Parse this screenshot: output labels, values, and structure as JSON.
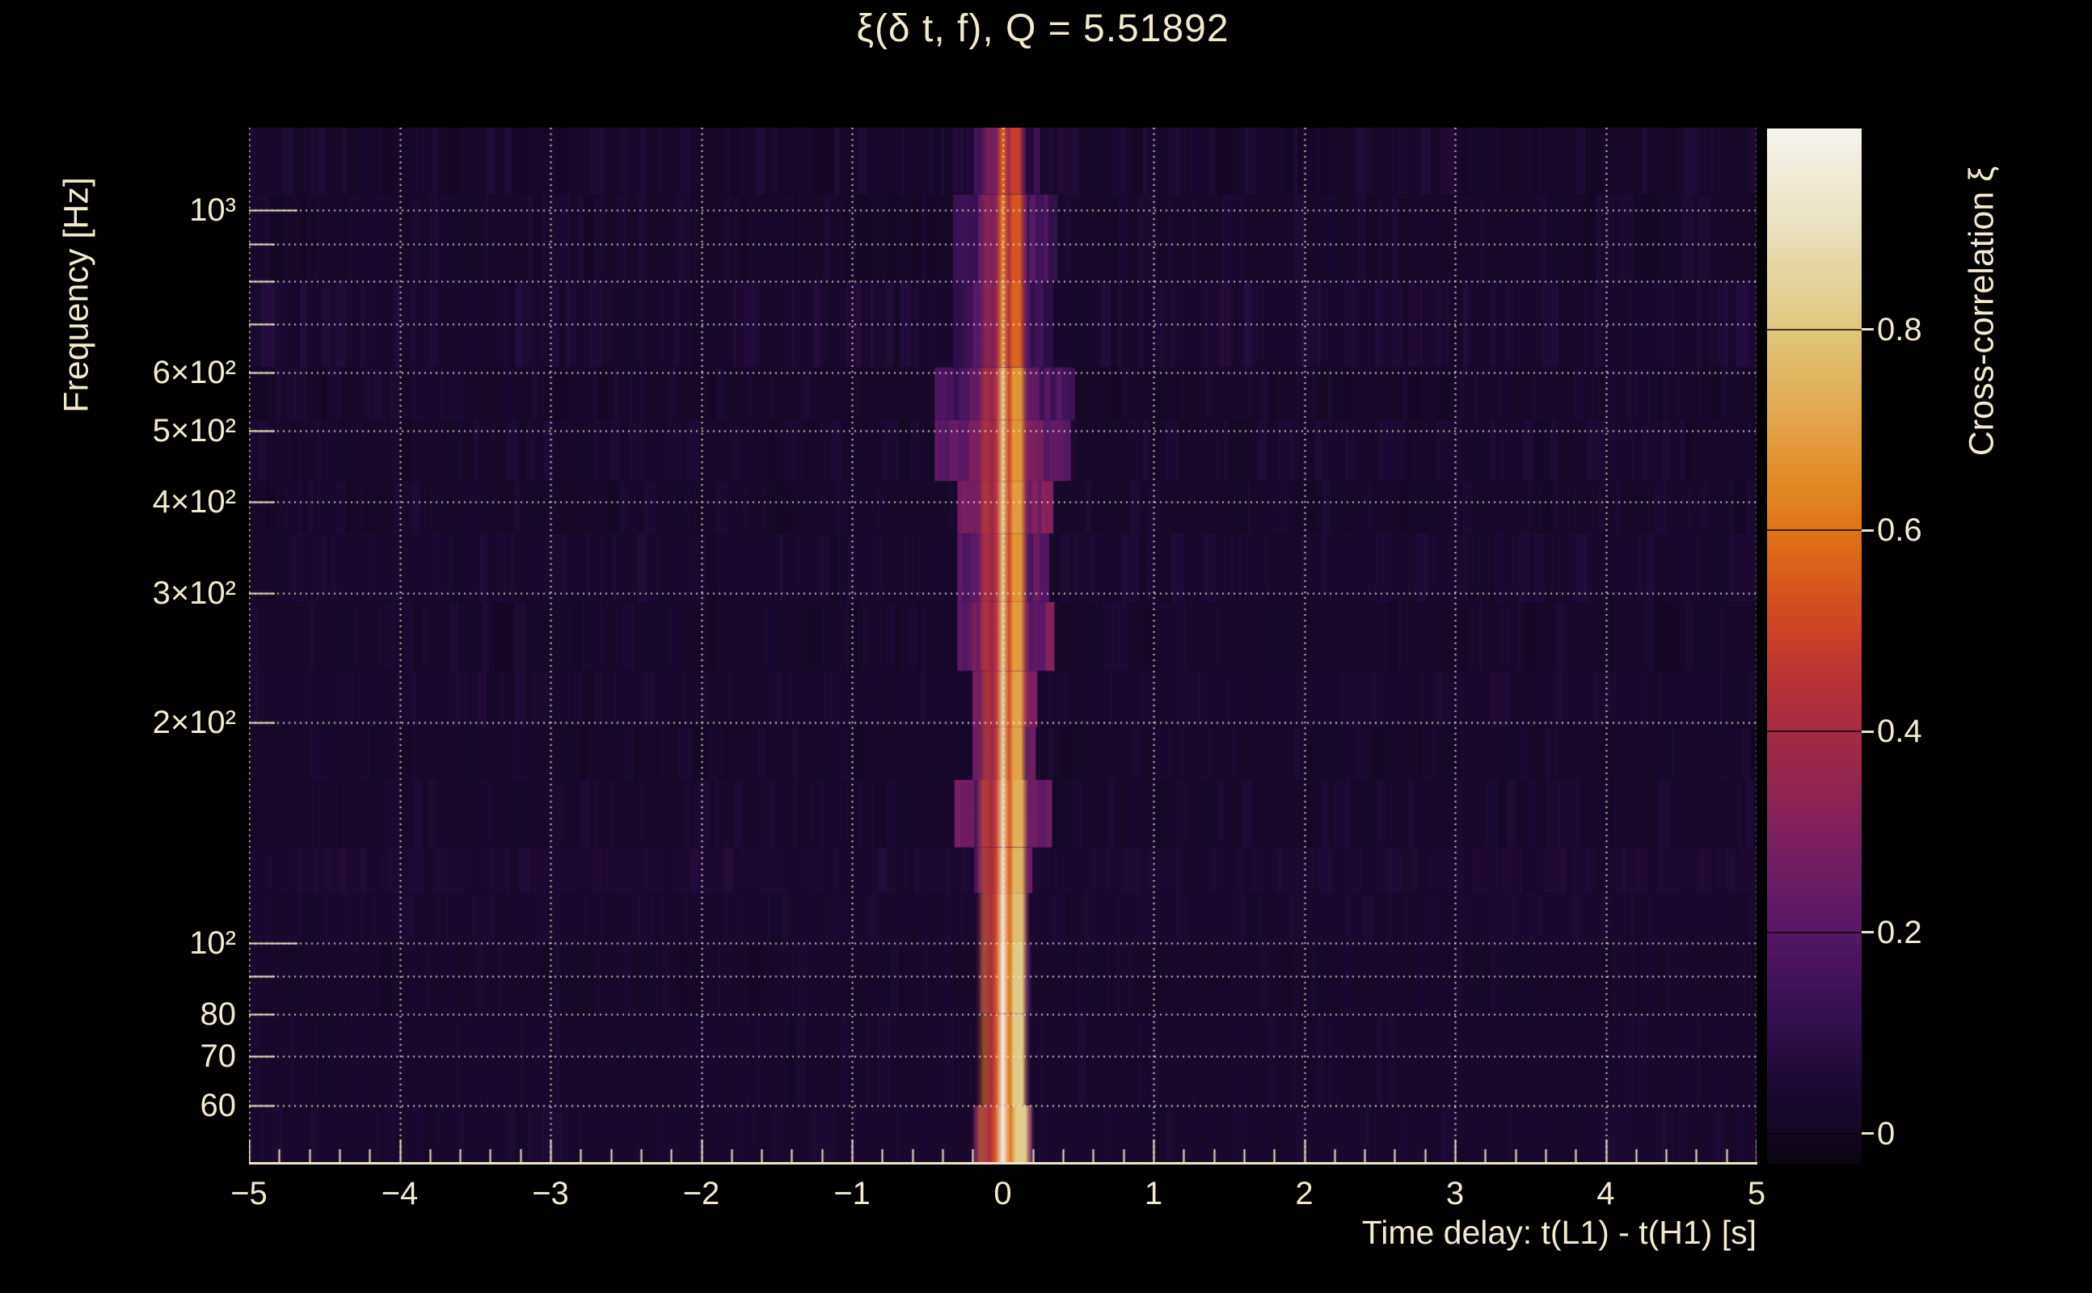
{
  "title": "ξ(δ t, f), Q = 5.51892",
  "q_value": "5.51892",
  "text_color": "#f2e9cf",
  "axis_color": "#efe5c6",
  "chart_data": {
    "type": "heatmap",
    "title": "ξ(δ t, f), Q = 5.51892",
    "xlabel": "Time delay: t(L1) - t(H1) [s]",
    "ylabel": "Frequency [Hz]",
    "colorbar_label": "Cross-correlation ξ",
    "x_range": [
      -5,
      5
    ],
    "y_range_hz": [
      50,
      1296
    ],
    "y_scale": "log",
    "z_range": [
      -0.03,
      1.0
    ],
    "grid": true,
    "peak_time_delay_s": 0,
    "x_ticks": [
      {
        "v": -5,
        "label": "−5"
      },
      {
        "v": -4,
        "label": "−4"
      },
      {
        "v": -3,
        "label": "−3"
      },
      {
        "v": -2,
        "label": "−2"
      },
      {
        "v": -1,
        "label": "−1"
      },
      {
        "v": 0,
        "label": "0"
      },
      {
        "v": 1,
        "label": "1"
      },
      {
        "v": 2,
        "label": "2"
      },
      {
        "v": 3,
        "label": "3"
      },
      {
        "v": 4,
        "label": "4"
      },
      {
        "v": 5,
        "label": "5"
      }
    ],
    "x_minor_step": 0.2,
    "y_ticks": [
      {
        "v": 1000,
        "label": "10³",
        "major": true
      },
      {
        "v": 600,
        "label": "6×10²",
        "major": false
      },
      {
        "v": 500,
        "label": "5×10²",
        "major": false
      },
      {
        "v": 400,
        "label": "4×10²",
        "major": false
      },
      {
        "v": 300,
        "label": "3×10²",
        "major": false
      },
      {
        "v": 200,
        "label": "2×10²",
        "major": false
      },
      {
        "v": 100,
        "label": "10²",
        "major": true
      },
      {
        "v": 80,
        "label": "80",
        "major": false
      },
      {
        "v": 70,
        "label": "70",
        "major": false
      },
      {
        "v": 60,
        "label": "60",
        "major": false
      }
    ],
    "y_minor_unlabeled": [
      90,
      700,
      800,
      900
    ],
    "grid_y_hz": [
      60,
      70,
      80,
      90,
      100,
      200,
      300,
      400,
      500,
      600,
      700,
      800,
      900,
      1000
    ],
    "colorbar_ticks": [
      {
        "v": 0.8,
        "label": "0.8"
      },
      {
        "v": 0.6,
        "label": "0.6"
      },
      {
        "v": 0.4,
        "label": "0.4"
      },
      {
        "v": 0.2,
        "label": "0.2"
      },
      {
        "v": 0.0,
        "label": "0"
      }
    ],
    "colormap_stops": [
      [
        -0.03,
        "#0a050f"
      ],
      [
        0.0,
        "#130722"
      ],
      [
        0.05,
        "#1d0a33"
      ],
      [
        0.1,
        "#2e0f4a"
      ],
      [
        0.15,
        "#3f1358"
      ],
      [
        0.2,
        "#571866"
      ],
      [
        0.25,
        "#6b1c64"
      ],
      [
        0.3,
        "#7f205c"
      ],
      [
        0.35,
        "#93254f"
      ],
      [
        0.4,
        "#a62b44"
      ],
      [
        0.45,
        "#b93336"
      ],
      [
        0.5,
        "#cc4226"
      ],
      [
        0.55,
        "#d95a1b"
      ],
      [
        0.6,
        "#e07317"
      ],
      [
        0.65,
        "#e28a26"
      ],
      [
        0.7,
        "#e2a043"
      ],
      [
        0.75,
        "#e0b45f"
      ],
      [
        0.8,
        "#dfc77c"
      ],
      [
        0.85,
        "#e3d49c"
      ],
      [
        0.9,
        "#e9e0bd"
      ],
      [
        0.95,
        "#efead7"
      ],
      [
        1.0,
        "#f4f2ec"
      ]
    ],
    "noise_seed": 11,
    "bands": [
      {
        "f_hi": 1296,
        "f_lo": 1050,
        "halo_s": 0.24,
        "halo_v": 0.1,
        "bg": 0.022,
        "core": 0.58,
        "cw": 0.07,
        "n": 1.3
      },
      {
        "f_hi": 1050,
        "f_lo": 800,
        "halo_s": 0.33,
        "halo_v": 0.14,
        "bg": 0.018,
        "core": 0.64,
        "cw": 0.08,
        "n": 1.0
      },
      {
        "f_hi": 800,
        "f_lo": 610,
        "halo_s": 0.33,
        "halo_v": 0.13,
        "bg": 0.032,
        "core": 0.68,
        "cw": 0.08,
        "n": 1.2
      },
      {
        "f_hi": 610,
        "f_lo": 517,
        "halo_s": 0.45,
        "halo_v": 0.16,
        "bg": 0.018,
        "core": 0.8,
        "cw": 0.09,
        "n": 0.9
      },
      {
        "f_hi": 517,
        "f_lo": 427,
        "halo_s": 0.45,
        "halo_v": 0.22,
        "bg": 0.022,
        "core": 0.8,
        "cw": 0.09,
        "n": 1.0
      },
      {
        "f_hi": 427,
        "f_lo": 362,
        "halo_s": 0.3,
        "halo_v": 0.26,
        "bg": 0.018,
        "core": 0.82,
        "cw": 0.09,
        "n": 0.9
      },
      {
        "f_hi": 362,
        "f_lo": 292,
        "halo_s": 0.3,
        "halo_v": 0.22,
        "bg": 0.028,
        "core": 0.8,
        "cw": 0.09,
        "n": 1.0
      },
      {
        "f_hi": 292,
        "f_lo": 235,
        "halo_s": 0.3,
        "halo_v": 0.24,
        "bg": 0.018,
        "core": 0.82,
        "cw": 0.09,
        "n": 0.9
      },
      {
        "f_hi": 235,
        "f_lo": 197,
        "halo_s": 0.2,
        "halo_v": 0.26,
        "bg": 0.028,
        "core": 0.84,
        "cw": 0.09,
        "n": 0.8
      },
      {
        "f_hi": 197,
        "f_lo": 167,
        "halo_s": 0.2,
        "halo_v": 0.2,
        "bg": 0.018,
        "core": 0.84,
        "cw": 0.09,
        "n": 0.8
      },
      {
        "f_hi": 167,
        "f_lo": 135,
        "halo_s": 0.32,
        "halo_v": 0.22,
        "bg": 0.022,
        "core": 0.88,
        "cw": 0.1,
        "n": 0.9
      },
      {
        "f_hi": 135,
        "f_lo": 117,
        "halo_s": 0.19,
        "halo_v": 0.18,
        "bg": 0.038,
        "core": 0.9,
        "cw": 0.1,
        "n": 0.8
      },
      {
        "f_hi": 117,
        "f_lo": 100,
        "halo_s": 0.15,
        "halo_v": 0.16,
        "bg": 0.028,
        "core": 0.93,
        "cw": 0.1,
        "n": 0.7
      },
      {
        "f_hi": 100,
        "f_lo": 80,
        "halo_s": 0.15,
        "halo_v": 0.14,
        "bg": 0.018,
        "core": 0.97,
        "cw": 0.1,
        "n": 0.7
      },
      {
        "f_hi": 80,
        "f_lo": 60,
        "halo_s": 0.13,
        "halo_v": 0.13,
        "bg": 0.024,
        "core": 0.97,
        "cw": 0.1,
        "n": 0.7
      },
      {
        "f_hi": 60,
        "f_lo": 50,
        "halo_s": 0.19,
        "halo_v": 0.2,
        "bg": 0.028,
        "core": 0.98,
        "cw": 0.13,
        "n": 0.7
      }
    ]
  }
}
